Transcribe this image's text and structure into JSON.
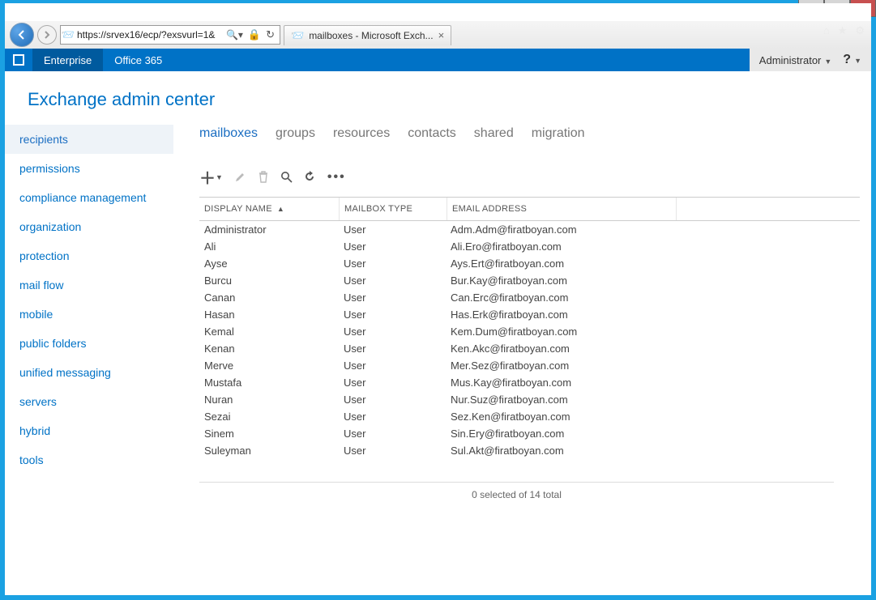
{
  "window": {
    "title": "mailboxes - Microsoft Exch..."
  },
  "address": {
    "url": "https://srvex16/ecp/?exsvurl=1&"
  },
  "ribbon": {
    "enterprise": "Enterprise",
    "office365": "Office 365",
    "admin": "Administrator",
    "help": "?"
  },
  "page": {
    "title": "Exchange admin center"
  },
  "sidebar": {
    "items": [
      "recipients",
      "permissions",
      "compliance management",
      "organization",
      "protection",
      "mail flow",
      "mobile",
      "public folders",
      "unified messaging",
      "servers",
      "hybrid",
      "tools"
    ],
    "selected": 0
  },
  "tabs": {
    "items": [
      "mailboxes",
      "groups",
      "resources",
      "contacts",
      "shared",
      "migration"
    ],
    "selected": 0
  },
  "columns": {
    "display_name": "DISPLAY NAME",
    "mailbox_type": "MAILBOX TYPE",
    "email": "EMAIL ADDRESS"
  },
  "rows": [
    {
      "name": "Administrator",
      "type": "User",
      "email": "Adm.Adm@firatboyan.com"
    },
    {
      "name": "Ali",
      "type": "User",
      "email": "Ali.Ero@firatboyan.com"
    },
    {
      "name": "Ayse",
      "type": "User",
      "email": "Ays.Ert@firatboyan.com"
    },
    {
      "name": "Burcu",
      "type": "User",
      "email": "Bur.Kay@firatboyan.com"
    },
    {
      "name": "Canan",
      "type": "User",
      "email": "Can.Erc@firatboyan.com"
    },
    {
      "name": "Hasan",
      "type": "User",
      "email": "Has.Erk@firatboyan.com"
    },
    {
      "name": "Kemal",
      "type": "User",
      "email": "Kem.Dum@firatboyan.com"
    },
    {
      "name": "Kenan",
      "type": "User",
      "email": "Ken.Akc@firatboyan.com"
    },
    {
      "name": "Merve",
      "type": "User",
      "email": "Mer.Sez@firatboyan.com"
    },
    {
      "name": "Mustafa",
      "type": "User",
      "email": "Mus.Kay@firatboyan.com"
    },
    {
      "name": "Nuran",
      "type": "User",
      "email": "Nur.Suz@firatboyan.com"
    },
    {
      "name": "Sezai",
      "type": "User",
      "email": "Sez.Ken@firatboyan.com"
    },
    {
      "name": "Sinem",
      "type": "User",
      "email": "Sin.Ery@firatboyan.com"
    },
    {
      "name": "Suleyman",
      "type": "User",
      "email": "Sul.Akt@firatboyan.com"
    }
  ],
  "status": "0 selected of 14 total"
}
